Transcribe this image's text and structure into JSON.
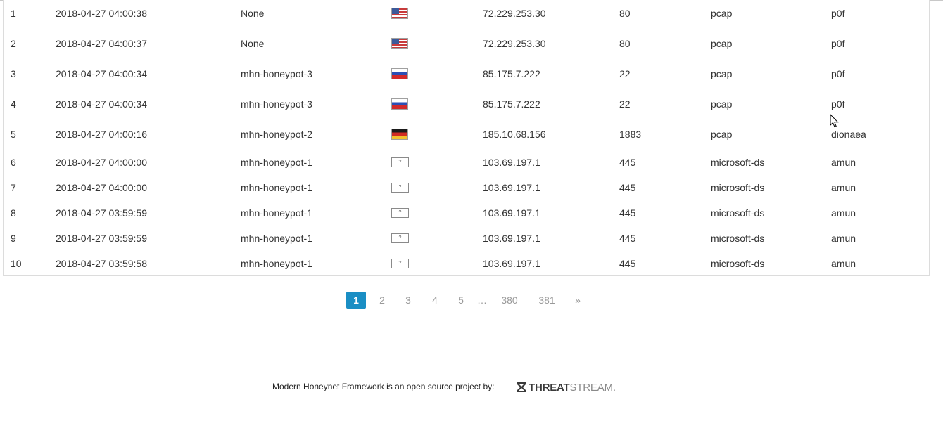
{
  "attacks": {
    "rows": [
      {
        "num": "1",
        "date": "2018-04-27 04:00:38",
        "sensor": "None",
        "country": "us-flag",
        "ip": "72.229.253.30",
        "port": "80",
        "protocol": "pcap",
        "honeypot": "p0f"
      },
      {
        "num": "2",
        "date": "2018-04-27 04:00:37",
        "sensor": "None",
        "country": "us-flag",
        "ip": "72.229.253.30",
        "port": "80",
        "protocol": "pcap",
        "honeypot": "p0f"
      },
      {
        "num": "3",
        "date": "2018-04-27 04:00:34",
        "sensor": "mhn-honeypot-3",
        "country": "ru-flag",
        "ip": "85.175.7.222",
        "port": "22",
        "protocol": "pcap",
        "honeypot": "p0f"
      },
      {
        "num": "4",
        "date": "2018-04-27 04:00:34",
        "sensor": "mhn-honeypot-3",
        "country": "ru-flag",
        "ip": "85.175.7.222",
        "port": "22",
        "protocol": "pcap",
        "honeypot": "p0f"
      },
      {
        "num": "5",
        "date": "2018-04-27 04:00:16",
        "sensor": "mhn-honeypot-2",
        "country": "de-flag",
        "ip": "185.10.68.156",
        "port": "1883",
        "protocol": "pcap",
        "honeypot": "dionaea"
      },
      {
        "num": "6",
        "date": "2018-04-27 04:00:00",
        "sensor": "mhn-honeypot-1",
        "country": "unknown-flag",
        "ip": "103.69.197.1",
        "port": "445",
        "protocol": "microsoft-ds",
        "honeypot": "amun"
      },
      {
        "num": "7",
        "date": "2018-04-27 04:00:00",
        "sensor": "mhn-honeypot-1",
        "country": "unknown-flag",
        "ip": "103.69.197.1",
        "port": "445",
        "protocol": "microsoft-ds",
        "honeypot": "amun"
      },
      {
        "num": "8",
        "date": "2018-04-27 03:59:59",
        "sensor": "mhn-honeypot-1",
        "country": "unknown-flag",
        "ip": "103.69.197.1",
        "port": "445",
        "protocol": "microsoft-ds",
        "honeypot": "amun"
      },
      {
        "num": "9",
        "date": "2018-04-27 03:59:59",
        "sensor": "mhn-honeypot-1",
        "country": "unknown-flag",
        "ip": "103.69.197.1",
        "port": "445",
        "protocol": "microsoft-ds",
        "honeypot": "amun"
      },
      {
        "num": "10",
        "date": "2018-04-27 03:59:58",
        "sensor": "mhn-honeypot-1",
        "country": "unknown-flag",
        "ip": "103.69.197.1",
        "port": "445",
        "protocol": "microsoft-ds",
        "honeypot": "amun"
      }
    ]
  },
  "pagination": {
    "items": [
      "1",
      "2",
      "3",
      "4",
      "5",
      "…",
      "380",
      "381",
      "»"
    ],
    "active": "1"
  },
  "footer": {
    "text": "Modern Honeynet Framework is an open source project by:",
    "logo_bold": "THREAT",
    "logo_light": "STREAM."
  },
  "colors": {
    "accent": "#1a8ec4",
    "border": "#dcdcdc"
  }
}
